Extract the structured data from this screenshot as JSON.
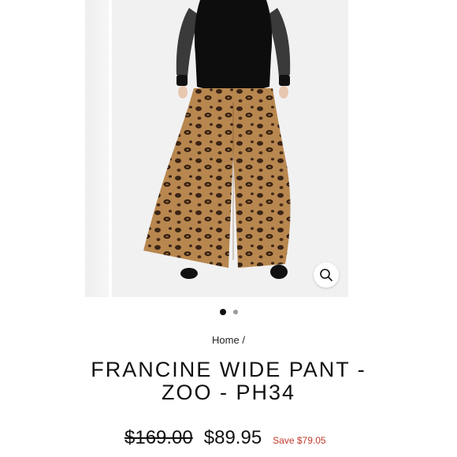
{
  "gallery": {
    "zoom_icon": "search-magnifier-icon",
    "slide_count": 2,
    "active_slide": 1
  },
  "breadcrumb": {
    "home_label": "Home",
    "separator": "/"
  },
  "product": {
    "title": "FRANCINE WIDE PANT - ZOO - PH34",
    "compare_price": "$169.00",
    "price": "$89.95",
    "savings": "Save $79.05"
  },
  "colors": {
    "savings": "#c0392b",
    "text": "#111111"
  }
}
